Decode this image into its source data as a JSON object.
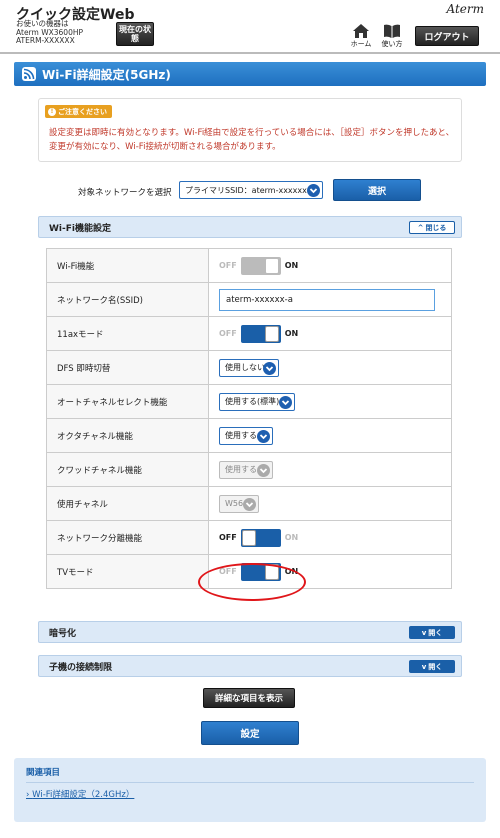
{
  "header": {
    "app_title": "クイック設定Web",
    "device_line1": "お使いの機器は",
    "device_line2": "Aterm WX3600HP",
    "device_line3": "ATERM-XXXXXX",
    "status_button": "現在の状態",
    "brand": "Aterm",
    "home_label": "ホーム",
    "manual_label": "使い方",
    "logout_label": "ログアウト"
  },
  "page": {
    "title": "Wi-Fi詳細設定(5GHz)"
  },
  "notice": {
    "badge": "ご注意ください",
    "text": "設定変更は即時に有効となります。Wi-Fi経由で設定を行っている場合には、［設定］ボタンを押したあと、変更が有効になり、Wi-Fi接続が切断される場合があります。"
  },
  "network_select": {
    "label": "対象ネットワークを選択",
    "value": "プライマリSSID：aterm-xxxxxx-a",
    "button": "選択"
  },
  "wifi_section": {
    "title": "Wi-Fi機能設定",
    "toggle_label": "閉じる",
    "rows": [
      {
        "label": "Wi-Fi機能",
        "type": "toggle",
        "state": "on",
        "disabled": true,
        "off": "OFF",
        "on": "ON"
      },
      {
        "label": "ネットワーク名(SSID)",
        "type": "text",
        "value": "aterm-xxxxxx-a"
      },
      {
        "label": "11axモード",
        "type": "toggle",
        "state": "on",
        "disabled": false,
        "off": "OFF",
        "on": "ON"
      },
      {
        "label": "DFS 即時切替",
        "type": "select",
        "value": "使用しない",
        "disabled": false
      },
      {
        "label": "オートチャネルセレクト機能",
        "type": "select",
        "value": "使用する(標準)",
        "disabled": false
      },
      {
        "label": "オクタチャネル機能",
        "type": "select",
        "value": "使用する",
        "disabled": false
      },
      {
        "label": "クワッドチャネル機能",
        "type": "select",
        "value": "使用する",
        "disabled": true
      },
      {
        "label": "使用チャネル",
        "type": "select",
        "value": "W56",
        "disabled": true
      },
      {
        "label": "ネットワーク分離機能",
        "type": "toggle",
        "state": "off",
        "disabled": false,
        "off": "OFF",
        "on": "ON"
      },
      {
        "label": "TVモード",
        "type": "toggle",
        "state": "on",
        "disabled": false,
        "off": "OFF",
        "on": "ON"
      }
    ]
  },
  "encryption_section": {
    "title": "暗号化",
    "toggle_label": "開く"
  },
  "child_section": {
    "title": "子機の接続制限",
    "toggle_label": "開く"
  },
  "detail_button": "詳細な項目を表示",
  "set_button": "設定",
  "related": {
    "title": "関連項目",
    "link": "Wi-Fi詳細設定（2.4GHz）"
  },
  "colors": {
    "accent_blue": "#1a5fa8",
    "notice_red": "#c0392b",
    "highlight_circle": "#e0161a"
  }
}
